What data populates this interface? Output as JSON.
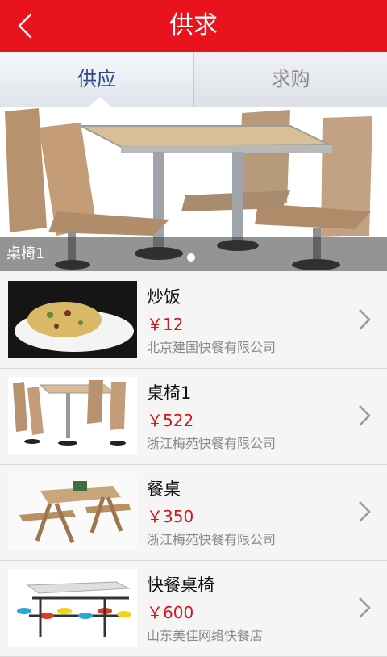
{
  "header": {
    "title": "供求"
  },
  "tabs": [
    {
      "label": "供应"
    },
    {
      "label": "求购"
    }
  ],
  "banner": {
    "caption": "桌椅1"
  },
  "items": [
    {
      "name": "炒饭",
      "price": "￥12",
      "company": "北京建国快餐有限公司"
    },
    {
      "name": "桌椅1",
      "price": "￥522",
      "company": "浙江梅苑快餐有限公司"
    },
    {
      "name": "餐桌",
      "price": "￥350",
      "company": "浙江梅苑快餐有限公司"
    },
    {
      "name": "快餐桌椅",
      "price": "￥600",
      "company": "山东美佳网络快餐店"
    }
  ],
  "colors": {
    "accent": "#e8131d",
    "price": "#d0171f",
    "tab_active": "#2b4a86"
  }
}
